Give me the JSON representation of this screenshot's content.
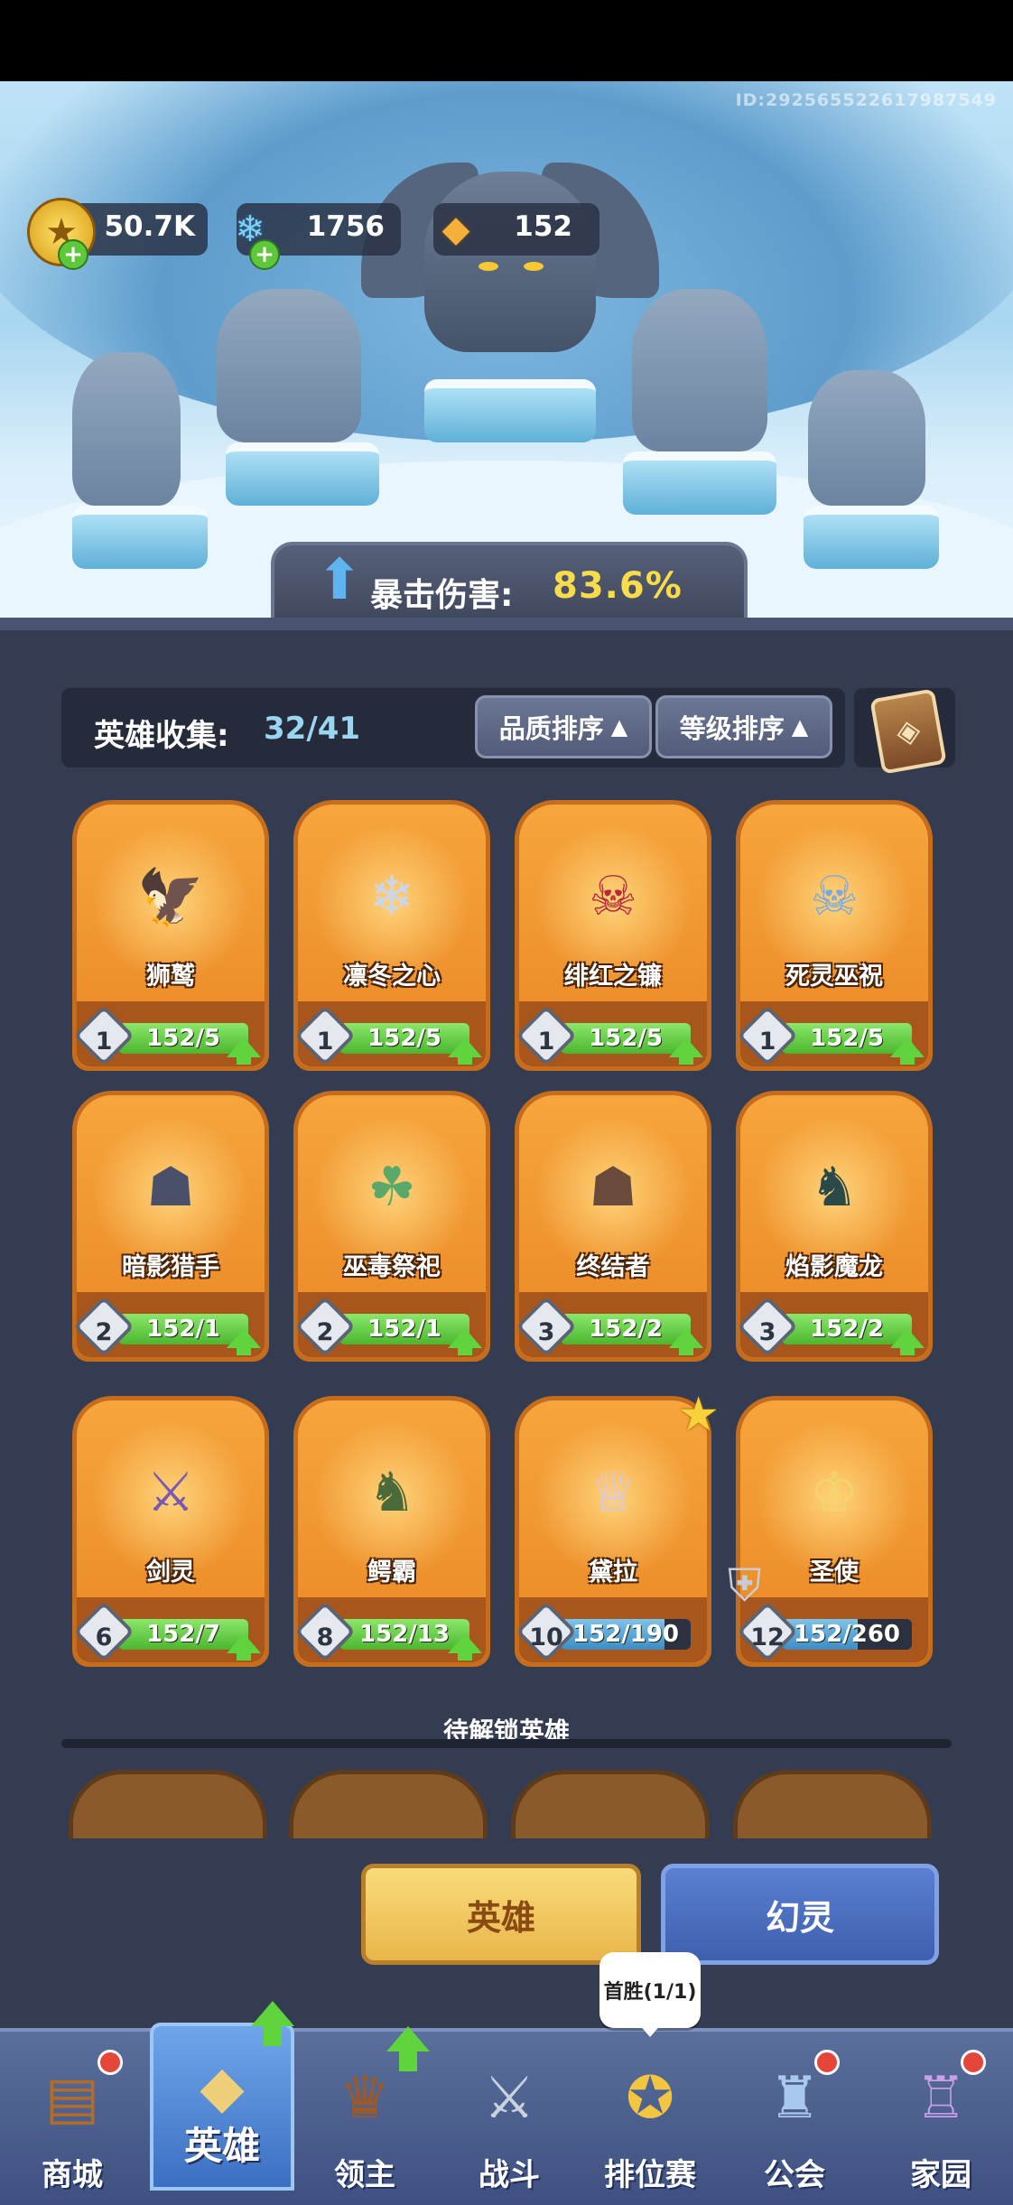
{
  "player_id": "ID:292565522617987549",
  "currencies": [
    {
      "name": "gold",
      "icon": "gold-coin-icon",
      "value": "50.7K"
    },
    {
      "name": "crystal",
      "icon": "ice-crystal-icon",
      "value": "1756"
    },
    {
      "name": "amber",
      "icon": "amber-crystal-icon",
      "value": "152"
    }
  ],
  "crit": {
    "label": "暴击伤害:",
    "value": "83.6%"
  },
  "collection": {
    "label": "英雄收集:",
    "count": "32/41"
  },
  "sort": {
    "quality": "品质排序",
    "level": "等级排序"
  },
  "heroes": [
    {
      "name": "狮鹫",
      "level": "1",
      "progress": "152/5",
      "fill": 1.0
    },
    {
      "name": "凛冬之心",
      "level": "1",
      "progress": "152/5",
      "fill": 1.0
    },
    {
      "name": "绯红之镰",
      "level": "1",
      "progress": "152/5",
      "fill": 1.0
    },
    {
      "name": "死灵巫祝",
      "level": "1",
      "progress": "152/5",
      "fill": 1.0
    },
    {
      "name": "暗影猎手",
      "level": "2",
      "progress": "152/1",
      "fill": 1.0
    },
    {
      "name": "巫毒祭祀",
      "level": "2",
      "progress": "152/1",
      "fill": 1.0
    },
    {
      "name": "终结者",
      "level": "3",
      "progress": "152/2",
      "fill": 1.0
    },
    {
      "name": "焰影魔龙",
      "level": "3",
      "progress": "152/2",
      "fill": 1.0
    },
    {
      "name": "剑灵",
      "level": "6",
      "progress": "152/7",
      "fill": 1.0
    },
    {
      "name": "鳄霸",
      "level": "8",
      "progress": "152/13",
      "fill": 1.0
    },
    {
      "name": "黛拉",
      "level": "10",
      "progress": "152/190",
      "fill": 0.8
    },
    {
      "name": "圣使",
      "level": "12",
      "progress": "152/260",
      "fill": 0.58
    }
  ],
  "pending": {
    "title": "待解锁英雄"
  },
  "tabs": {
    "hero": "英雄",
    "phantom": "幻灵"
  },
  "first_win": "首胜(1/1)",
  "nav": [
    {
      "label": "商城",
      "icon": "shop-chest-icon"
    },
    {
      "label": "英雄",
      "icon": "hero-card-icon"
    },
    {
      "label": "领主",
      "icon": "lord-banner-icon"
    },
    {
      "label": "战斗",
      "icon": "battle-swords-icon"
    },
    {
      "label": "排位赛",
      "icon": "ranked-shield-icon"
    },
    {
      "label": "公会",
      "icon": "guild-castle-icon"
    },
    {
      "label": "家园",
      "icon": "home-castle-icon"
    }
  ],
  "colors": {
    "crit_value": "#f8dc4c",
    "collect_count": "#9ad6f2",
    "progress_fill": "#4cb62e",
    "tab_active": "#e9b64a",
    "tab_inactive": "#3d5fae"
  }
}
